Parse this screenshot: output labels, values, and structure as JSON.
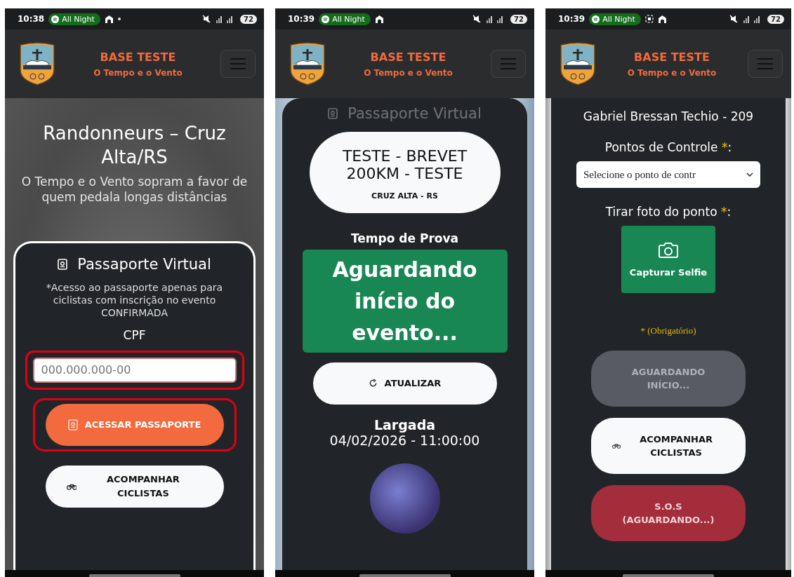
{
  "screens": [
    {
      "status_bar": {
        "time": "10:38",
        "media": "All Night",
        "dot": true,
        "cast": false,
        "battery": "72"
      },
      "header": {
        "title": "BASE TESTE",
        "subtitle": "O Tempo e o Vento"
      },
      "hero": {
        "title": "Randonneurs – Cruz Alta/RS",
        "subtitle": "O Tempo e o Vento sopram a favor de quem pedala longas distâncias"
      },
      "card": [
        {
          "kind": "heading",
          "text": "Passaporte Virtual",
          "faded": false
        },
        {
          "kind": "note",
          "text": "*Acesso ao passaporte apenas para ciclistas com inscrição no evento CONFIRMADA"
        },
        {
          "kind": "label",
          "text": "CPF"
        },
        {
          "kind": "field",
          "placeholder": "000.000.000-00",
          "highlighted": true
        },
        {
          "kind": "access-button",
          "text": "ACESSAR PASSAPORTE",
          "highlighted": true
        },
        {
          "kind": "follow-button",
          "text": "ACOMPANHAR CICLISTAS",
          "highlighted": false
        }
      ]
    },
    {
      "status_bar": {
        "time": "10:39",
        "media": "All Night",
        "dot": false,
        "cast": false,
        "battery": "72"
      },
      "header": {
        "title": "BASE TESTE",
        "subtitle": "O Tempo e o Vento"
      },
      "card": [
        {
          "kind": "heading",
          "text": "Passaporte Virtual",
          "faded": true
        },
        {
          "kind": "event",
          "title": "TESTE - BREVET 200KM - TESTE",
          "subtitle": "CRUZ ALTA - RS"
        },
        {
          "kind": "title",
          "text": "Tempo de Prova"
        },
        {
          "kind": "status",
          "text": "Aguardando início do evento..."
        },
        {
          "kind": "refresh-button",
          "text": "ATUALIZAR"
        },
        {
          "kind": "start",
          "title": "Largada",
          "text": "04/02/2026 - 11:00:00"
        },
        {
          "kind": "avatar"
        }
      ]
    },
    {
      "status_bar": {
        "time": "10:39",
        "media": "All Night",
        "dot": false,
        "cast": true,
        "battery": "72"
      },
      "header": {
        "title": "BASE TESTE",
        "subtitle": "O Tempo e o Vento"
      },
      "card": [
        {
          "kind": "name",
          "text": "Gabriel Bressan Techio - 209"
        },
        {
          "kind": "required-label",
          "text": "Pontos de Controle",
          "mark": "*",
          "suffix": ":"
        },
        {
          "kind": "select",
          "value": "Selecione o ponto de contr"
        },
        {
          "kind": "required-label",
          "text": "Tirar foto do ponto",
          "mark": "*",
          "suffix": ":"
        },
        {
          "kind": "capture",
          "text": "Capturar Selfie"
        },
        {
          "kind": "hint",
          "text": "* (Obrigatório)"
        },
        {
          "kind": "waiting-button",
          "text": "AGUARDANDO INÍCIO..."
        },
        {
          "kind": "follow-button",
          "text": "ACOMPANHAR CICLISTAS"
        },
        {
          "kind": "sos-button",
          "text": "S.O.S (AGUARDANDO...)"
        }
      ]
    }
  ]
}
